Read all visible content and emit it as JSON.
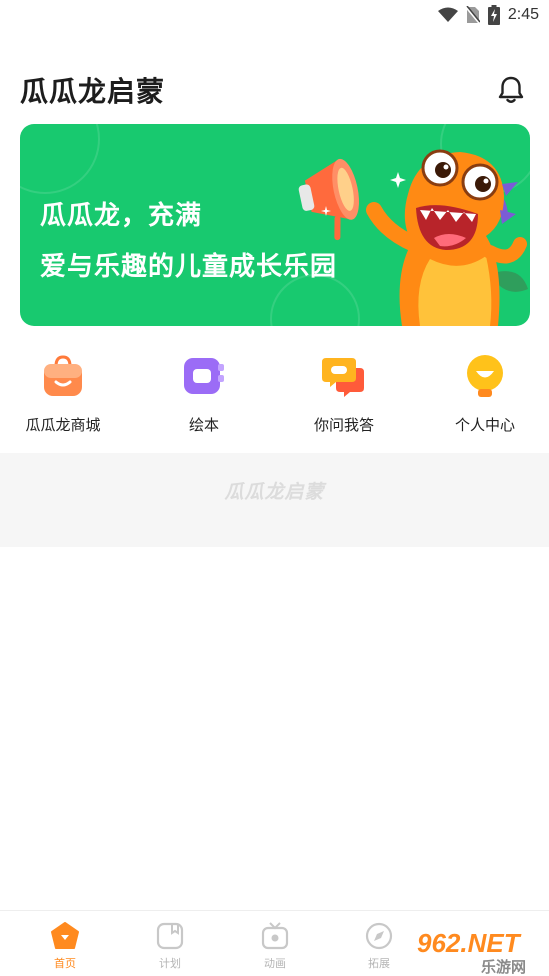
{
  "status_bar": {
    "time": "2:45",
    "icons": [
      "wifi-icon",
      "no-sim-icon",
      "battery-charging-icon"
    ]
  },
  "header": {
    "title": "瓜瓜龙启蒙",
    "notification_icon": "bell-icon"
  },
  "banner": {
    "line1": "瓜瓜龙，充满",
    "line2": "爱与乐趣的儿童成长乐园",
    "background": "#18c96f",
    "illustration": "dinosaur-megaphone-illustration"
  },
  "shortcuts": [
    {
      "label": "瓜瓜龙商城",
      "icon": "shopping-bag-icon",
      "color": "#ff8a4c"
    },
    {
      "label": "绘本",
      "icon": "picture-book-icon",
      "color": "#9b6cf6"
    },
    {
      "label": "你问我答",
      "icon": "chat-bubble-icon",
      "color": "#ffb41f"
    },
    {
      "label": "个人中心",
      "icon": "lightbulb-icon",
      "color": "#ffc21a"
    }
  ],
  "placeholder": {
    "text": "瓜瓜龙启蒙"
  },
  "bottom_nav": [
    {
      "label": "首页",
      "icon": "home-icon",
      "active": true
    },
    {
      "label": "计划",
      "icon": "plan-icon",
      "active": false
    },
    {
      "label": "动画",
      "icon": "tv-icon",
      "active": false
    },
    {
      "label": "拓展",
      "icon": "compass-icon",
      "active": false
    }
  ],
  "watermark": {
    "text": "962.NET",
    "subtext": "乐游网"
  },
  "colors": {
    "accent": "#ff8a1f",
    "banner": "#18c96f",
    "nav_inactive": "#b5b5b5"
  }
}
